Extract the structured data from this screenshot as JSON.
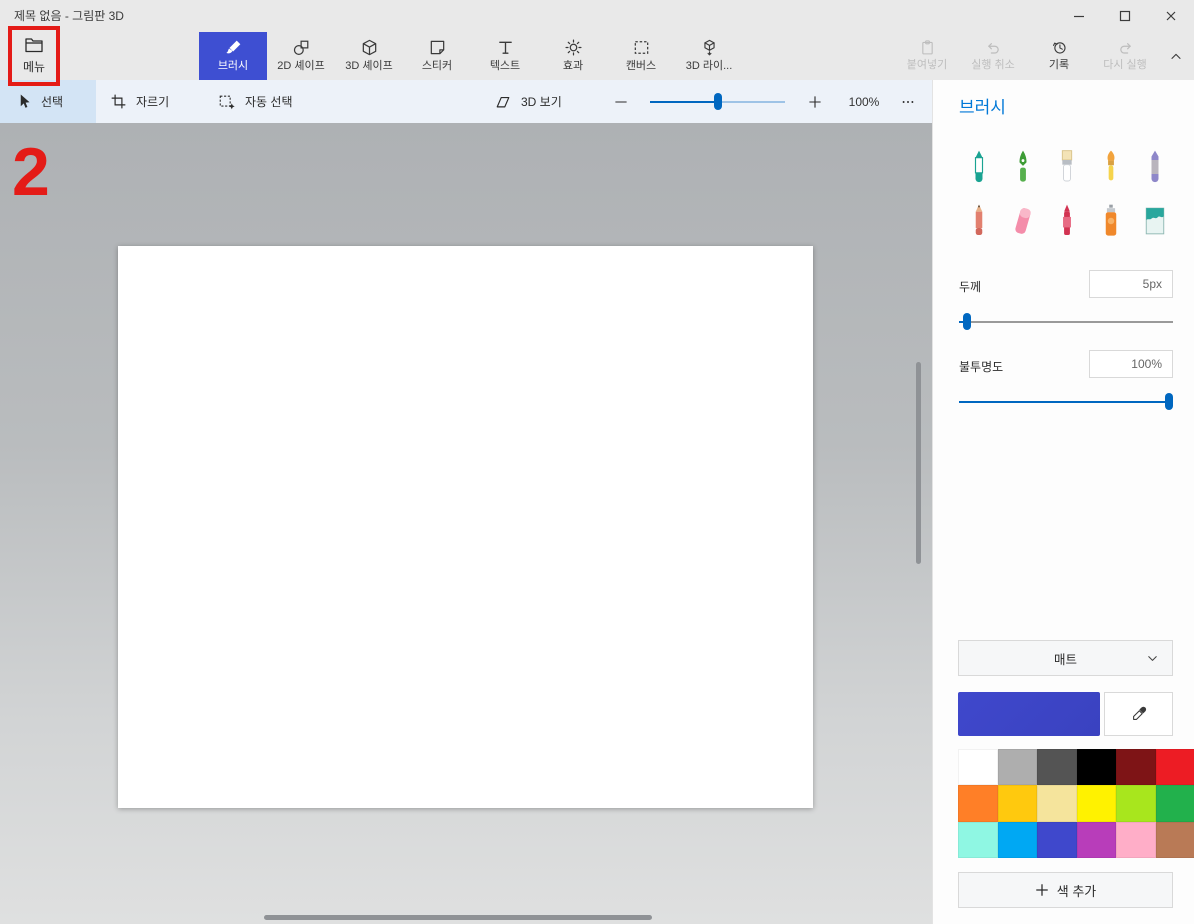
{
  "window": {
    "title": "제목 없음 - 그림판 3D"
  },
  "ribbon": {
    "menu_label": "메뉴",
    "tabs": [
      {
        "label": "브러시",
        "selected": true
      },
      {
        "label": "2D 셰이프",
        "selected": false
      },
      {
        "label": "3D 셰이프",
        "selected": false
      },
      {
        "label": "스티커",
        "selected": false
      },
      {
        "label": "텍스트",
        "selected": false
      },
      {
        "label": "효과",
        "selected": false
      },
      {
        "label": "캔버스",
        "selected": false
      },
      {
        "label": "3D 라이...",
        "selected": false
      }
    ],
    "actions": {
      "paste": "붙여넣기",
      "undo": "실행 취소",
      "history": "기록",
      "redo": "다시 실행"
    },
    "disabled_actions": [
      "paste",
      "undo",
      "redo"
    ]
  },
  "toolbar": {
    "select_label": "선택",
    "crop_label": "자르기",
    "magic_select_label": "자동 선택",
    "view3d_label": "3D 보기",
    "zoom_level": "100%"
  },
  "panel": {
    "title": "브러시",
    "brush_icons": [
      "marker-brush-icon",
      "calligraphy-pen-icon",
      "oil-brush-icon",
      "watercolor-brush-icon",
      "pixel-pen-icon",
      "pencil-icon",
      "eraser-icon",
      "crayon-icon",
      "spray-can-icon",
      "fill-bucket-icon"
    ],
    "thickness_label": "두께",
    "thickness_value": "5px",
    "opacity_label": "불투명도",
    "opacity_value": "100%",
    "material_label": "매트",
    "add_color_label": "색 추가",
    "current_color": "#3f48cc",
    "palette": [
      "#ffffff",
      "#aeaeae",
      "#545454",
      "#000000",
      "#7e1416",
      "#ed1c24",
      "#ff7f27",
      "#ffc90e",
      "#f5e49c",
      "#fff200",
      "#a8e61d",
      "#22b14c",
      "#8ff7e3",
      "#00a8f3",
      "#3f48cc",
      "#b83dba",
      "#ffaec8",
      "#b97a56"
    ]
  },
  "colors": {
    "accent": "#0067c0",
    "selected_tab": "#3e4fd2",
    "panel_title": "#0078d7",
    "annotation_red": "#e41b17"
  },
  "annotations": {
    "step_number": "2"
  }
}
